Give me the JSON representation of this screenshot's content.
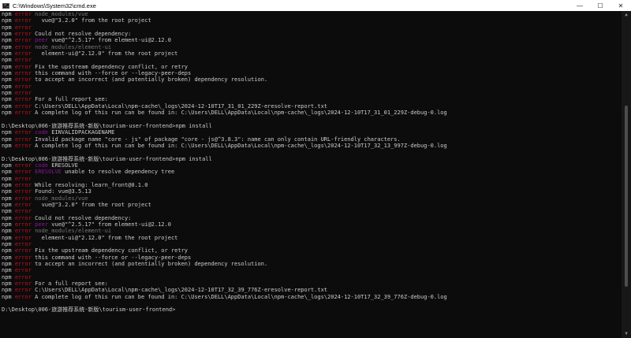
{
  "window": {
    "title": "C:\\Windows\\System32\\cmd.exe",
    "minimize": "—",
    "maximize": "☐",
    "close": "✕"
  },
  "colors": {
    "background": "#0c0c0c",
    "text": "#cccccc",
    "error": "#c50f1f",
    "code": "#881798",
    "dim": "#767676"
  },
  "lines": [
    {
      "pre": "npm ",
      "tag": "error",
      "tagClass": "err",
      "rest": " node_modules/vue",
      "restClass": "grey"
    },
    {
      "pre": "npm ",
      "tag": "error",
      "tagClass": "err",
      "rest": "   vue@\"3.2.0\" from the root project",
      "restClass": "pre"
    },
    {
      "pre": "npm ",
      "tag": "error",
      "tagClass": "err",
      "rest": "",
      "restClass": "pre"
    },
    {
      "pre": "npm ",
      "tag": "error",
      "tagClass": "err",
      "rest": " Could not resolve dependency:",
      "restClass": "pre"
    },
    {
      "pre": "npm ",
      "tag": "error",
      "tagClass": "err",
      "rest2a": " peer",
      "rest2aClass": "code",
      "rest": " vue@\"^2.5.17\" from element-ui@2.12.0",
      "restClass": "pre"
    },
    {
      "pre": "npm ",
      "tag": "error",
      "tagClass": "err",
      "rest": " node_modules/element-ui",
      "restClass": "grey"
    },
    {
      "pre": "npm ",
      "tag": "error",
      "tagClass": "err",
      "rest": "   element-ui@\"2.12.0\" from the root project",
      "restClass": "pre"
    },
    {
      "pre": "npm ",
      "tag": "error",
      "tagClass": "err",
      "rest": "",
      "restClass": "pre"
    },
    {
      "pre": "npm ",
      "tag": "error",
      "tagClass": "err",
      "rest": " Fix the upstream dependency conflict, or retry",
      "restClass": "pre"
    },
    {
      "pre": "npm ",
      "tag": "error",
      "tagClass": "err",
      "rest": " this command with --force or --legacy-peer-deps",
      "restClass": "pre"
    },
    {
      "pre": "npm ",
      "tag": "error",
      "tagClass": "err",
      "rest": " to accept an incorrect (and potentially broken) dependency resolution.",
      "restClass": "pre"
    },
    {
      "pre": "npm ",
      "tag": "error",
      "tagClass": "err",
      "rest": "",
      "restClass": "pre"
    },
    {
      "pre": "npm ",
      "tag": "error",
      "tagClass": "err",
      "rest": "",
      "restClass": "pre"
    },
    {
      "pre": "npm ",
      "tag": "error",
      "tagClass": "err",
      "rest": " For a full report see:",
      "restClass": "pre"
    },
    {
      "pre": "npm ",
      "tag": "error",
      "tagClass": "err",
      "rest": " C:\\Users\\DELL\\AppData\\Local\\npm-cache\\_logs\\2024-12-10T17_31_01_229Z-eresolve-report.txt",
      "restClass": "pre"
    },
    {
      "pre": "npm ",
      "tag": "error",
      "tagClass": "err",
      "rest": " A complete log of this run can be found in: C:\\Users\\DELL\\AppData\\Local\\npm-cache\\_logs\\2024-12-10T17_31_01_229Z-debug-0.log",
      "restClass": "pre"
    },
    {
      "blank": true
    },
    {
      "plain": "D:\\Desktop\\006-旅游推荐系统-新版\\tourism-user-frontend>npm install"
    },
    {
      "pre": "npm ",
      "tag": "error",
      "tagClass": "err",
      "rest2a": " code",
      "rest2aClass": "code",
      "rest": " EINVALIDPACKAGENAME",
      "restClass": "pre"
    },
    {
      "pre": "npm ",
      "tag": "error",
      "tagClass": "err",
      "rest": " Invalid package name \"core - js\" of package \"core - js@^3.8.3\": name can only contain URL-friendly characters.",
      "restClass": "pre"
    },
    {
      "pre": "npm ",
      "tag": "error",
      "tagClass": "err",
      "rest": " A complete log of this run can be found in: C:\\Users\\DELL\\AppData\\Local\\npm-cache\\_logs\\2024-12-10T17_32_13_997Z-debug-0.log",
      "restClass": "pre"
    },
    {
      "blank": true
    },
    {
      "plain": "D:\\Desktop\\006-旅游推荐系统-新版\\tourism-user-frontend>npm install"
    },
    {
      "pre": "npm ",
      "tag": "error",
      "tagClass": "err",
      "rest2a": " code",
      "rest2aClass": "code",
      "rest": " ERESOLVE",
      "restClass": "pre"
    },
    {
      "pre": "npm ",
      "tag": "error",
      "tagClass": "err",
      "rest2a": " ERESOLVE",
      "rest2aClass": "code",
      "rest": " unable to resolve dependency tree",
      "restClass": "pre"
    },
    {
      "pre": "npm ",
      "tag": "error",
      "tagClass": "err",
      "rest": "",
      "restClass": "pre"
    },
    {
      "pre": "npm ",
      "tag": "error",
      "tagClass": "err",
      "rest": " While resolving: learn_front@0.1.0",
      "restClass": "pre"
    },
    {
      "pre": "npm ",
      "tag": "error",
      "tagClass": "err",
      "rest": " Found: vue@3.5.13",
      "restClass": "pre"
    },
    {
      "pre": "npm ",
      "tag": "error",
      "tagClass": "err",
      "rest": " node_modules/vue",
      "restClass": "grey"
    },
    {
      "pre": "npm ",
      "tag": "error",
      "tagClass": "err",
      "rest": "   vue@\"3.2.0\" from the root project",
      "restClass": "pre"
    },
    {
      "pre": "npm ",
      "tag": "error",
      "tagClass": "err",
      "rest": "",
      "restClass": "pre"
    },
    {
      "pre": "npm ",
      "tag": "error",
      "tagClass": "err",
      "rest": " Could not resolve dependency:",
      "restClass": "pre"
    },
    {
      "pre": "npm ",
      "tag": "error",
      "tagClass": "err",
      "rest2a": " peer",
      "rest2aClass": "code",
      "rest": " vue@\"^2.5.17\" from element-ui@2.12.0",
      "restClass": "pre"
    },
    {
      "pre": "npm ",
      "tag": "error",
      "tagClass": "err",
      "rest": " node_modules/element-ui",
      "restClass": "grey"
    },
    {
      "pre": "npm ",
      "tag": "error",
      "tagClass": "err",
      "rest": "   element-ui@\"2.12.0\" from the root project",
      "restClass": "pre"
    },
    {
      "pre": "npm ",
      "tag": "error",
      "tagClass": "err",
      "rest": "",
      "restClass": "pre"
    },
    {
      "pre": "npm ",
      "tag": "error",
      "tagClass": "err",
      "rest": " Fix the upstream dependency conflict, or retry",
      "restClass": "pre"
    },
    {
      "pre": "npm ",
      "tag": "error",
      "tagClass": "err",
      "rest": " this command with --force or --legacy-peer-deps",
      "restClass": "pre"
    },
    {
      "pre": "npm ",
      "tag": "error",
      "tagClass": "err",
      "rest": " to accept an incorrect (and potentially broken) dependency resolution.",
      "restClass": "pre"
    },
    {
      "pre": "npm ",
      "tag": "error",
      "tagClass": "err",
      "rest": "",
      "restClass": "pre"
    },
    {
      "pre": "npm ",
      "tag": "error",
      "tagClass": "err",
      "rest": "",
      "restClass": "pre"
    },
    {
      "pre": "npm ",
      "tag": "error",
      "tagClass": "err",
      "rest": " For a full report see:",
      "restClass": "pre"
    },
    {
      "pre": "npm ",
      "tag": "error",
      "tagClass": "err",
      "rest": " C:\\Users\\DELL\\AppData\\Local\\npm-cache\\_logs\\2024-12-10T17_32_39_776Z-eresolve-report.txt",
      "restClass": "pre"
    },
    {
      "pre": "npm ",
      "tag": "error",
      "tagClass": "err",
      "rest": " A complete log of this run can be found in: C:\\Users\\DELL\\AppData\\Local\\npm-cache\\_logs\\2024-12-10T17_32_39_776Z-debug-0.log",
      "restClass": "pre"
    },
    {
      "blank": true
    },
    {
      "plain": "D:\\Desktop\\006-旅游推荐系统-新版\\tourism-user-frontend>"
    }
  ]
}
